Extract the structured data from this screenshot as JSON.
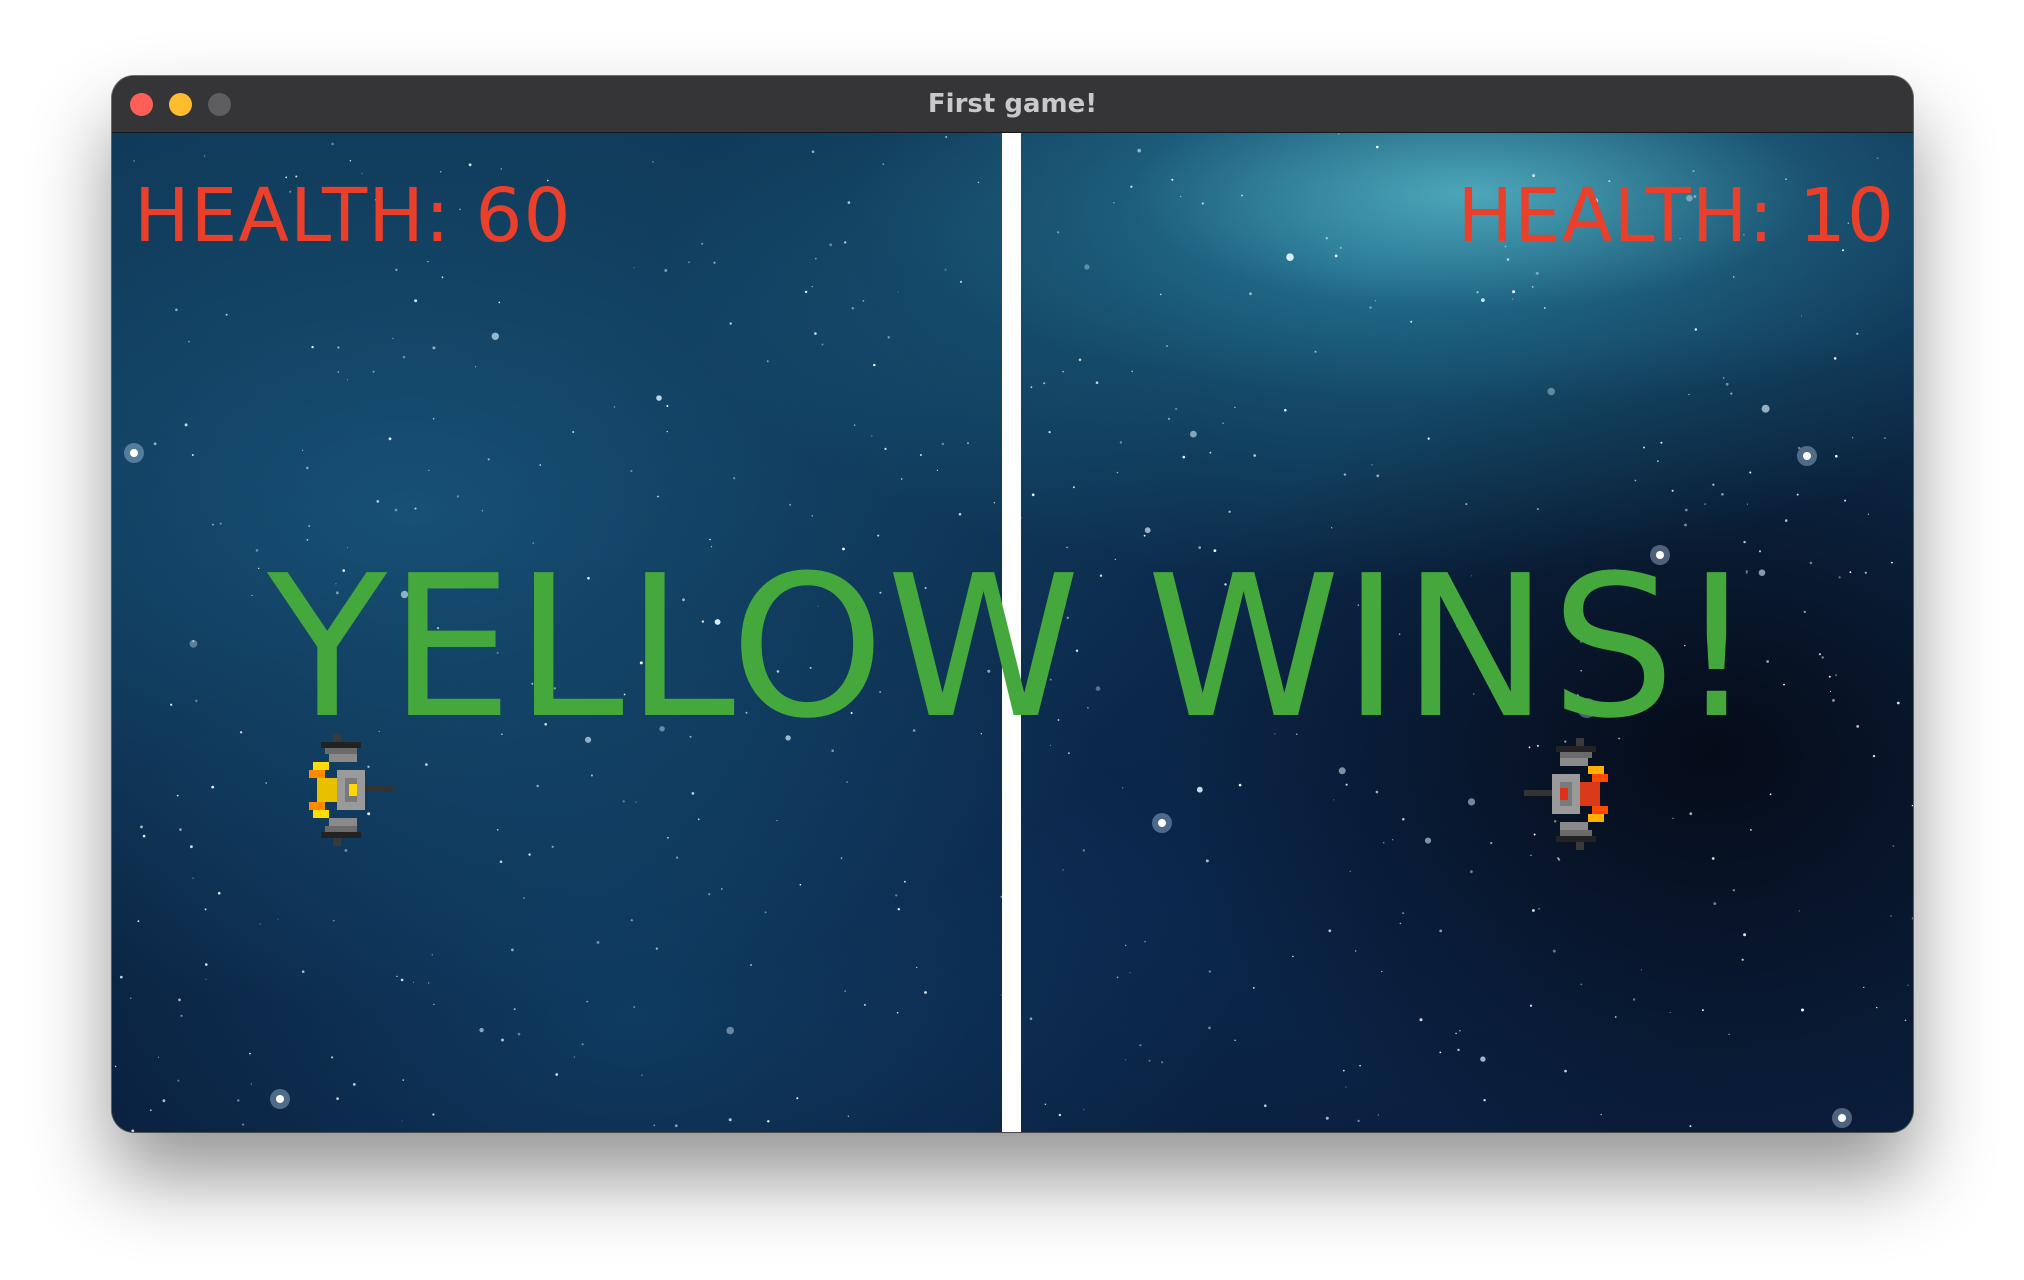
{
  "window": {
    "title": "First game!"
  },
  "game": {
    "left_health_label": "HEALTH: 60",
    "right_health_label": "HEALTH: 10",
    "winner_text": "YELLOW WINS!",
    "colors": {
      "health_text": "#ea3f2a",
      "winner_text": "#44a83d",
      "divider": "#ffffff",
      "background": "#0c2a4a"
    },
    "ships": [
      {
        "name": "yellow-spaceship",
        "facing": "right"
      },
      {
        "name": "red-spaceship",
        "facing": "left"
      }
    ]
  }
}
